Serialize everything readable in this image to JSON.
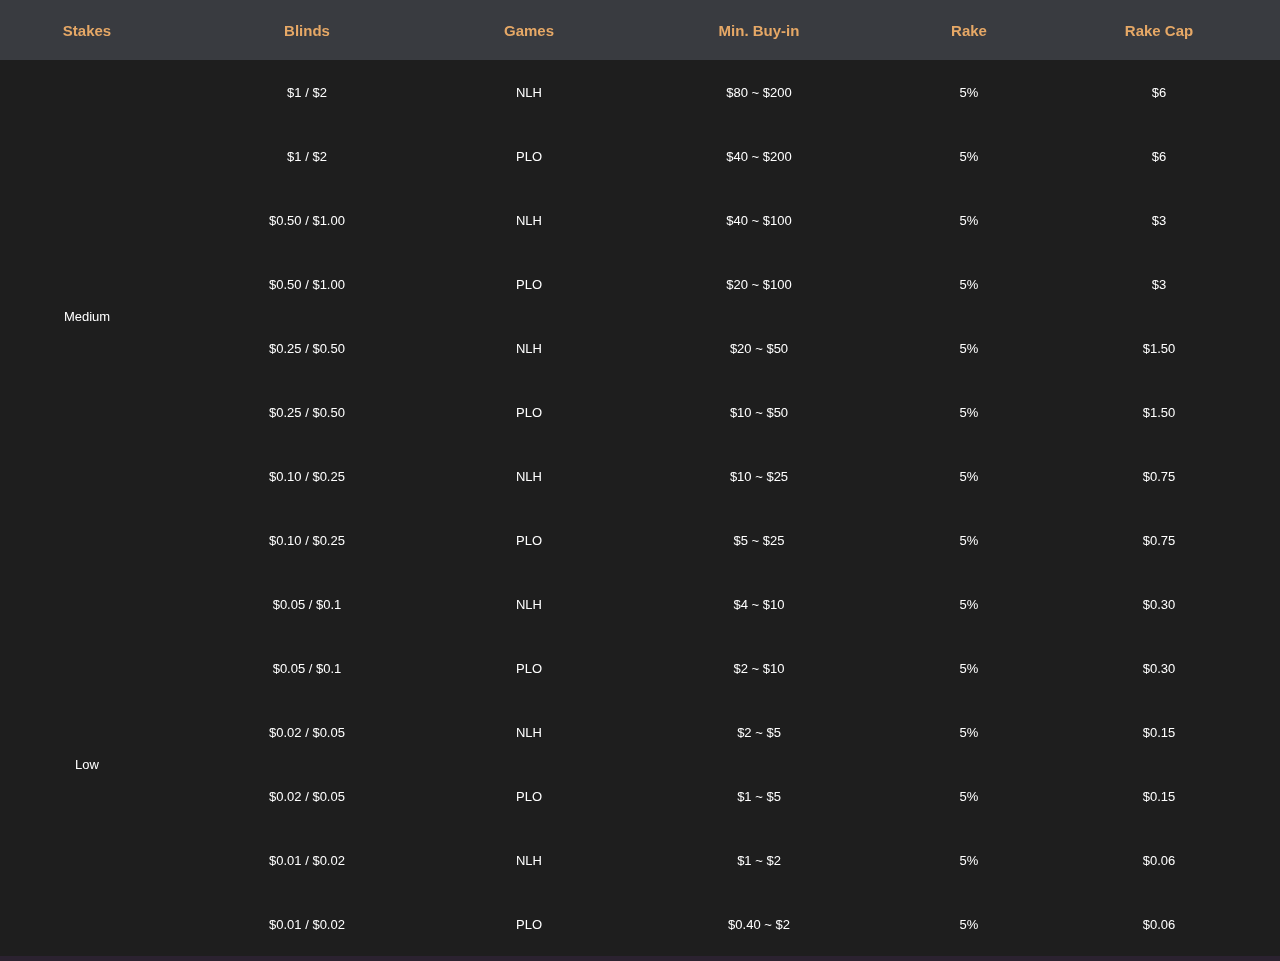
{
  "table": {
    "columns": [
      "Stakes",
      "Blinds",
      "Games",
      "Min. Buy-in",
      "Rake",
      "Rake Cap"
    ],
    "groups": [
      {
        "stakes": "Medium",
        "rows": [
          [
            "$1 / $2",
            "NLH",
            "$80 ~ $200",
            "5%",
            "$6"
          ],
          [
            "$1 / $2",
            "PLO",
            "$40 ~ $200",
            "5%",
            "$6"
          ],
          [
            "$0.50 / $1.00",
            "NLH",
            "$40 ~ $100",
            "5%",
            "$3"
          ],
          [
            "$0.50 / $1.00",
            "PLO",
            "$20 ~ $100",
            "5%",
            "$3"
          ],
          [
            "$0.25 / $0.50",
            "NLH",
            "$20 ~ $50",
            "5%",
            "$1.50"
          ],
          [
            "$0.25 / $0.50",
            "PLO",
            "$10 ~ $50",
            "5%",
            "$1.50"
          ],
          [
            "$0.10 / $0.25",
            "NLH",
            "$10 ~ $25",
            "5%",
            "$0.75"
          ],
          [
            "$0.10 / $0.25",
            "PLO",
            "$5 ~ $25",
            "5%",
            "$0.75"
          ]
        ]
      },
      {
        "stakes": "Low",
        "rows": [
          [
            "$0.05 / $0.1",
            "NLH",
            "$4 ~ $10",
            "5%",
            "$0.30"
          ],
          [
            "$0.05 / $0.1",
            "PLO",
            "$2 ~ $10",
            "5%",
            "$0.30"
          ],
          [
            "$0.02 / $0.05",
            "NLH",
            "$2 ~ $5",
            "5%",
            "$0.15"
          ],
          [
            "$0.02 / $0.05",
            "PLO",
            "$1 ~ $5",
            "5%",
            "$0.15"
          ],
          [
            "$0.01 / $0.02",
            "NLH",
            "$1 ~ $2",
            "5%",
            "$0.06"
          ],
          [
            "$0.01 / $0.02",
            "PLO",
            "$0.40 ~ $2",
            "5%",
            "$0.06"
          ]
        ]
      }
    ]
  }
}
